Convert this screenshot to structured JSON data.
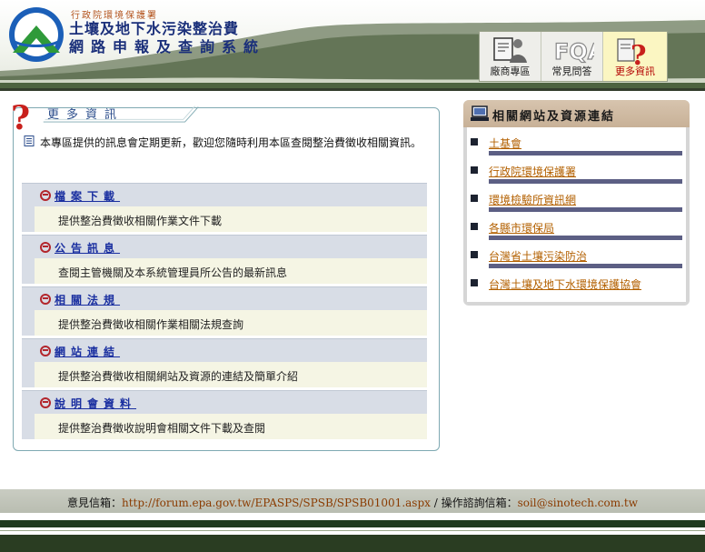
{
  "header": {
    "agency": "行政院環境保護署",
    "title_line1": "土壤及地下水污染整治費",
    "title_line2": "網路申報及查詢系統"
  },
  "topnav": {
    "tabs": [
      {
        "label": "廠商專區",
        "icon": "user-document-icon"
      },
      {
        "label": "常見問答",
        "icon": "faq-icon"
      },
      {
        "label": "更多資訊",
        "icon": "question-document-icon",
        "active": true
      }
    ]
  },
  "main": {
    "title": "更多資訊",
    "intro": "本專區提供的訊息會定期更新，歡迎您隨時利用本區查閱整治費徵收相關資訊。",
    "items": [
      {
        "label": "檔案下載",
        "desc": "提供整治費徵收相關作業文件下載"
      },
      {
        "label": "公告訊息",
        "desc": "查閱主管機關及本系統管理員所公告的最新訊息"
      },
      {
        "label": "相關法規",
        "desc": "提供整治費徵收相關作業相關法規查詢"
      },
      {
        "label": "網站連結",
        "desc": "提供整治費徵收相關網站及資源的連結及簡單介紹"
      },
      {
        "label": "說明會資料",
        "desc": "提供整治費徵收說明會相關文件下載及查閱"
      }
    ]
  },
  "sidebar": {
    "title": "相關網站及資源連結",
    "links": [
      {
        "label": "土基會"
      },
      {
        "label": "行政院環境保護署"
      },
      {
        "label": "環境檢驗所資訊網"
      },
      {
        "label": "各縣市環保局"
      },
      {
        "label": "台灣省土壤污染防治"
      },
      {
        "label": "台灣土壤及地下水環境保護協會"
      }
    ]
  },
  "footer": {
    "feedback_label": "意見信箱：",
    "feedback_url": "http://forum.epa.gov.tw/EPASPS/SPSB/SPSB01001.aspx",
    "separator": " / ",
    "contact_label": "操作諮詢信箱：",
    "contact_email": "soil@sinotech.com.tw"
  },
  "colors": {
    "accent_green": "#4d6340",
    "link_blue": "#1a2fa0",
    "link_orange": "#b36000",
    "alert_red": "#c8201c"
  }
}
